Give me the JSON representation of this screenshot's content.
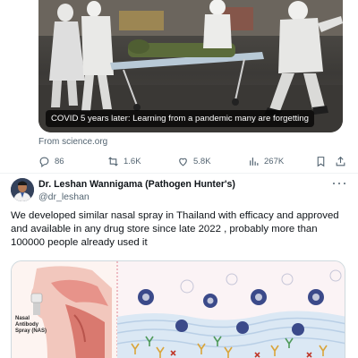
{
  "quoted_card": {
    "caption": "COVID 5 years later: Learning from a pandemic many are forgetting",
    "source": "From science.org"
  },
  "card_actions": {
    "replies": "86",
    "reposts": "1.6K",
    "likes": "5.8K",
    "views": "267K"
  },
  "tweet": {
    "display_name": "Dr. Leshan Wannigama (Pathogen Hunter's)",
    "handle": "@dr_leshan",
    "text": "We developed similar nasal spray in Thailand with efficacy and approved and available in any drug store since late 2022 , probably more than 100000 people already used it",
    "media_label": "Nasal Antibody Spray (NAS)"
  },
  "icons": {
    "reply": "reply-icon",
    "repost": "repost-icon",
    "like": "heart-icon",
    "views": "views-icon",
    "bookmark": "bookmark-icon",
    "share": "share-icon",
    "more": "more-icon"
  },
  "colors": {
    "text_primary": "#0f1419",
    "text_secondary": "#536471",
    "divider": "#eff3f4",
    "virus": "#3b4a8a"
  }
}
